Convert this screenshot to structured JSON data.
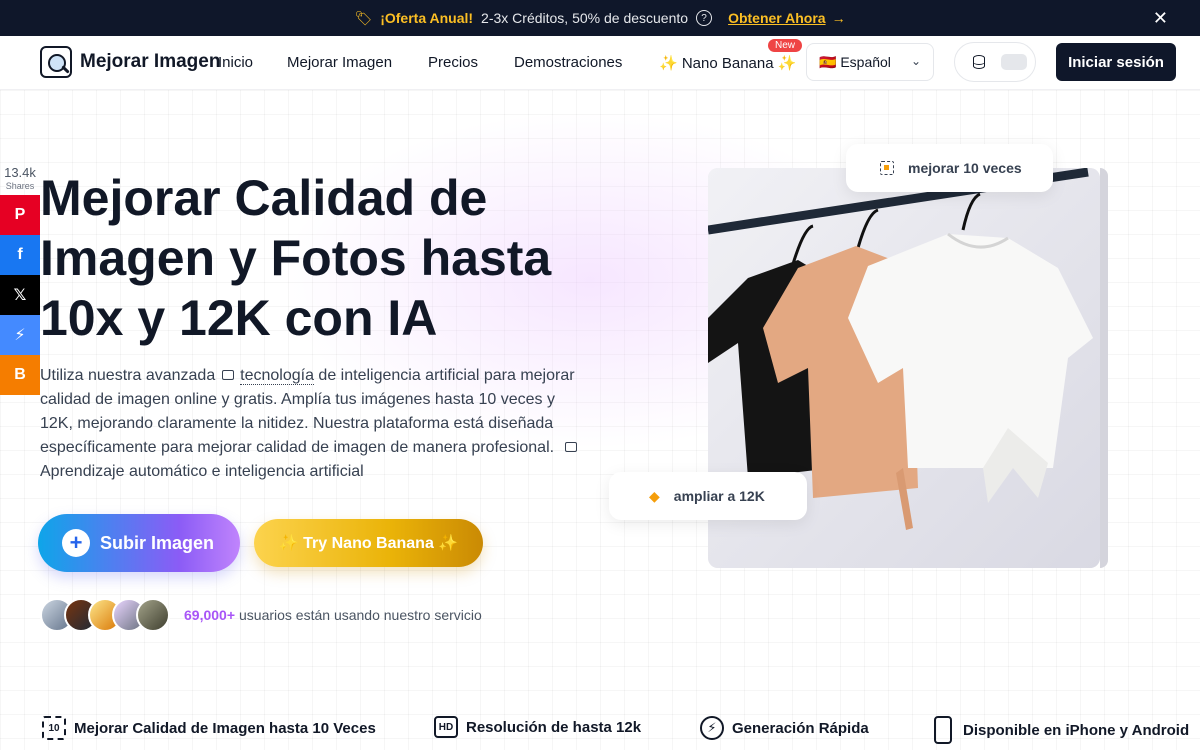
{
  "promo": {
    "highlight": "¡Oferta Anual!",
    "text": "2-3x Créditos, 50% de descuento",
    "cta": "Obtener Ahora",
    "colors": {
      "background": "#0f172a",
      "accent": "#fbbf24"
    }
  },
  "nav": {
    "logo_text": "Mejorar Imagen",
    "links": [
      "Inicio",
      "Mejorar Imagen",
      "Precios",
      "Demostraciones",
      "✨ Nano Banana ✨"
    ],
    "new_badge": "New",
    "language": "🇪🇸 Español",
    "login": "Iniciar sesión"
  },
  "share": {
    "count": "13.4k",
    "label": "Shares",
    "buttons": [
      {
        "name": "pinterest",
        "glyph": "P",
        "color": "#e60023"
      },
      {
        "name": "facebook",
        "glyph": "f",
        "color": "#1877f2"
      },
      {
        "name": "x",
        "glyph": "𝕏",
        "color": "#000000"
      },
      {
        "name": "messenger",
        "glyph": "⚡",
        "color": "#448aff"
      },
      {
        "name": "blogger",
        "glyph": "B",
        "color": "#f57d00"
      }
    ]
  },
  "hero": {
    "title": "Mejorar Calidad de Imagen y Fotos hasta 10x y 12K con IA",
    "desc_1": "Utiliza nuestra avanzada",
    "desc_link": "tecnología",
    "desc_2": "de inteligencia artificial para mejorar calidad de imagen online y gratis. Amplía tus imágenes hasta 10 veces y 12K, mejorando claramente la nitidez. Nuestra plataforma está diseñada específicamente para mejorar calidad de imagen de manera profesional.",
    "desc_3": "Aprendizaje automático e inteligencia artificial",
    "upload_button": "Subir Imagen",
    "nano_button": "✨ Try Nano Banana ✨",
    "users_count": "69,000+",
    "users_text": "usuarios están usando nuestro servicio",
    "label_enhance": "mejorar 10 veces",
    "label_upscale": "ampliar a 12K"
  },
  "features": [
    {
      "icon": "upscale-10x-icon",
      "label": "Mejorar Calidad de Imagen hasta 10 Veces"
    },
    {
      "icon": "hd-icon",
      "label": "Resolución de hasta 12k"
    },
    {
      "icon": "lightning-icon",
      "label": "Generación Rápida"
    },
    {
      "icon": "phone-icon",
      "label": "Disponible en iPhone y Android"
    }
  ]
}
